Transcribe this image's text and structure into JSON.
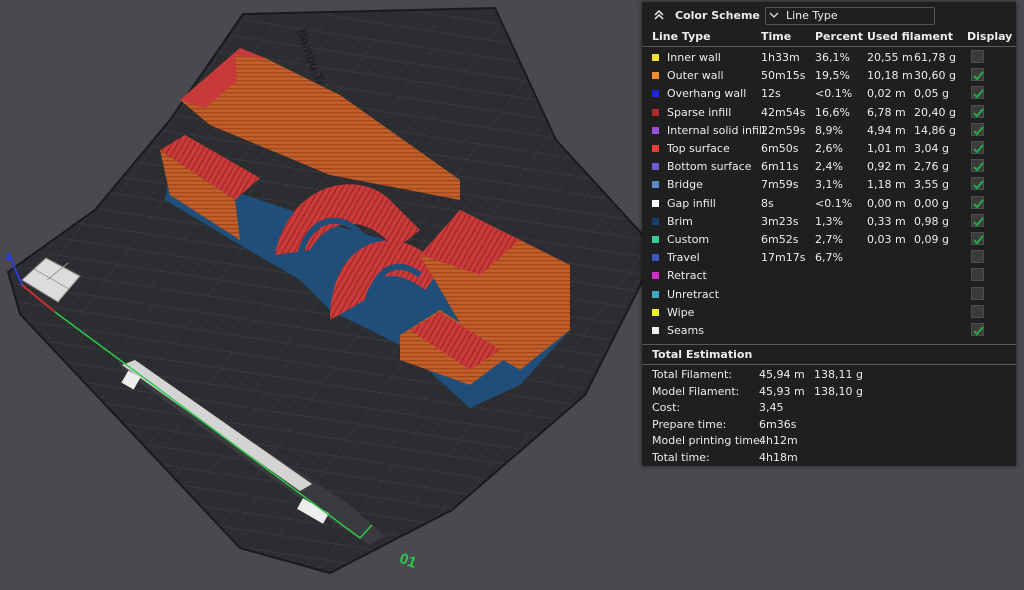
{
  "viewport": {
    "bed_brand_text": "Bambu Te",
    "plate_number": "01",
    "colors": {
      "background": "#484a4f",
      "bed": "#2c2d30",
      "model_wall": "#c0602a",
      "model_top": "#c83a3a",
      "brim": "#1f4e79",
      "x_axis": "#2ec84a"
    }
  },
  "panel": {
    "header": {
      "title": "Color Scheme",
      "scheme_value": "Line Type",
      "collapse_icon": "chevron-up-double-icon",
      "dropdown_icon": "chevron-down-icon"
    },
    "columns": {
      "line_type": "Line Type",
      "time": "Time",
      "percent": "Percent",
      "used_filament": "Used filament",
      "display": "Display"
    },
    "rows": [
      {
        "name": "Inner wall",
        "color": "#f0de3c",
        "time": "1h33m",
        "percent": "36,1%",
        "length": "20,55 m",
        "weight": "61,78 g",
        "display": false
      },
      {
        "name": "Outer wall",
        "color": "#f08c2e",
        "time": "50m15s",
        "percent": "19,5%",
        "length": "10,18 m",
        "weight": "30,60 g",
        "display": true
      },
      {
        "name": "Overhang wall",
        "color": "#1f24e0",
        "time": "12s",
        "percent": "<0.1%",
        "length": "0,02 m",
        "weight": "0,05 g",
        "display": true
      },
      {
        "name": "Sparse infill",
        "color": "#b02a2a",
        "time": "42m54s",
        "percent": "16,6%",
        "length": "6,78 m",
        "weight": "20,40 g",
        "display": true
      },
      {
        "name": "Internal solid infill",
        "color": "#9a4fd6",
        "time": "22m59s",
        "percent": "8,9%",
        "length": "4,94 m",
        "weight": "14,86 g",
        "display": true
      },
      {
        "name": "Top surface",
        "color": "#f03a3a",
        "time": "6m50s",
        "percent": "2,6%",
        "length": "1,01 m",
        "weight": "3,04 g",
        "display": true
      },
      {
        "name": "Bottom surface",
        "color": "#6a5fd0",
        "time": "6m11s",
        "percent": "2,4%",
        "length": "0,92 m",
        "weight": "2,76 g",
        "display": true
      },
      {
        "name": "Bridge",
        "color": "#5a88c8",
        "time": "7m59s",
        "percent": "3,1%",
        "length": "1,18 m",
        "weight": "3,55 g",
        "display": true
      },
      {
        "name": "Gap infill",
        "color": "#ffffff",
        "time": "8s",
        "percent": "<0.1%",
        "length": "0,00 m",
        "weight": "0,00 g",
        "display": true
      },
      {
        "name": "Brim",
        "color": "#1a3f6e",
        "time": "3m23s",
        "percent": "1,3%",
        "length": "0,33 m",
        "weight": "0,98 g",
        "display": true
      },
      {
        "name": "Custom",
        "color": "#40c890",
        "time": "6m52s",
        "percent": "2,7%",
        "length": "0,03 m",
        "weight": "0,09 g",
        "display": true
      },
      {
        "name": "Travel",
        "color": "#3a58c0",
        "time": "17m17s",
        "percent": "6,7%",
        "length": "",
        "weight": "",
        "display": false
      },
      {
        "name": "Retract",
        "color": "#d030c8",
        "time": "",
        "percent": "",
        "length": "",
        "weight": "",
        "display": false
      },
      {
        "name": "Unretract",
        "color": "#40a8c0",
        "time": "",
        "percent": "",
        "length": "",
        "weight": "",
        "display": false
      },
      {
        "name": "Wipe",
        "color": "#f0f020",
        "time": "",
        "percent": "",
        "length": "",
        "weight": "",
        "display": false
      },
      {
        "name": "Seams",
        "color": "#f0f0f0",
        "time": "",
        "percent": "",
        "length": "",
        "weight": "",
        "display": true
      }
    ],
    "estimation": {
      "title": "Total Estimation",
      "items": [
        {
          "label": "Total Filament:",
          "v1": "45,94 m",
          "v2": "138,11 g"
        },
        {
          "label": "Model Filament:",
          "v1": "45,93 m",
          "v2": "138,10 g"
        },
        {
          "label": "Cost:",
          "v1": "3,45",
          "v2": ""
        },
        {
          "label": "Prepare time:",
          "v1": "6m36s",
          "v2": ""
        },
        {
          "label": "Model printing time:",
          "v1": "4h12m",
          "v2": ""
        },
        {
          "label": "Total time:",
          "v1": "4h18m",
          "v2": ""
        }
      ]
    }
  }
}
